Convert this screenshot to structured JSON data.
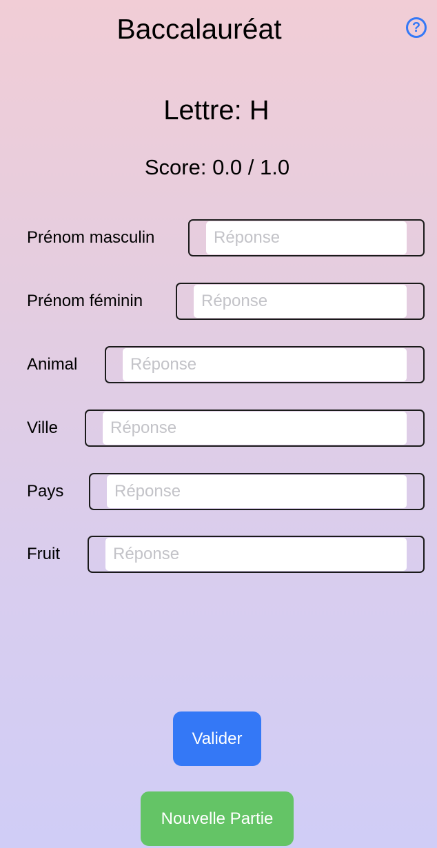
{
  "header": {
    "title": "Baccalauréat",
    "help_symbol": "?",
    "help_icon": "question-circle-icon",
    "accent_color": "#3478f6"
  },
  "game": {
    "letter_text": "Lettre: H",
    "score_text": "Score: 0.0 / 1.0"
  },
  "fields": [
    {
      "label": "Prénom masculin",
      "placeholder": "Réponse",
      "value": ""
    },
    {
      "label": "Prénom féminin",
      "placeholder": "Réponse",
      "value": ""
    },
    {
      "label": "Animal",
      "placeholder": "Réponse",
      "value": ""
    },
    {
      "label": "Ville",
      "placeholder": "Réponse",
      "value": ""
    },
    {
      "label": "Pays",
      "placeholder": "Réponse",
      "value": ""
    },
    {
      "label": "Fruit",
      "placeholder": "Réponse",
      "value": ""
    }
  ],
  "actions": {
    "validate_label": "Valider",
    "validate_color": "#3478f6",
    "new_game_label": "Nouvelle Partie",
    "new_game_color": "#64c466"
  }
}
